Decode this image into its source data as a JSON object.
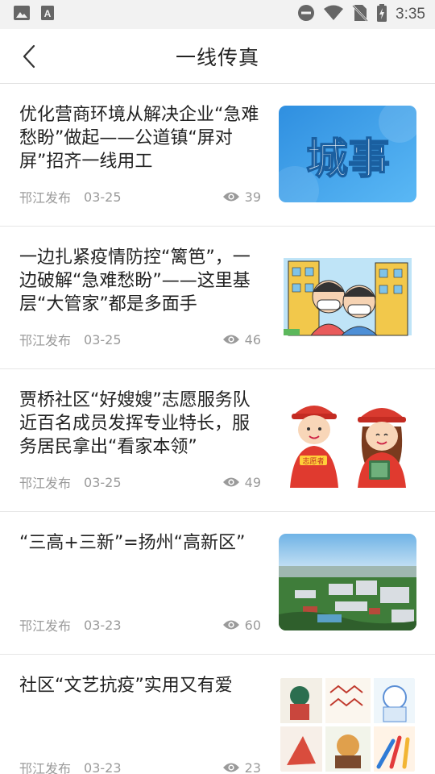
{
  "status_bar": {
    "time": "3:35",
    "icons": [
      "image-icon",
      "text-a-icon",
      "do-not-disturb-icon",
      "wifi-icon",
      "no-sim-icon",
      "battery-charging-icon"
    ]
  },
  "header": {
    "title": "一线传真",
    "back_icon": "chevron-left-icon"
  },
  "articles": [
    {
      "title": "优化营商环境从解决企业“急难愁盼”做起——公道镇“屏对屏”招齐一线用工",
      "source": "邗江发布",
      "date": "03-25",
      "views": "39",
      "thumb_text": "城事",
      "thumb_icon": "city-news-banner"
    },
    {
      "title": "一边扎紧疫情防控“篱笆”，一边破解“急难愁盼”——这里基层“大管家”都是多面手",
      "source": "邗江发布",
      "date": "03-25",
      "views": "46",
      "thumb_icon": "masked-workers-illustration"
    },
    {
      "title": "贾桥社区“好嫂嫂”志愿服务队近百名成员发挥专业特长，服务居民拿出“看家本领”",
      "source": "邗江发布",
      "date": "03-25",
      "views": "49",
      "thumb_text": "志愿者",
      "thumb_icon": "volunteers-illustration"
    },
    {
      "title": "“三高+三新”=扬州“高新区”",
      "source": "邗江发布",
      "date": "03-23",
      "views": "60",
      "thumb_icon": "aerial-city-photo"
    },
    {
      "title": "社区“文艺抗疫”实用又有爱",
      "source": "邗江发布",
      "date": "03-23",
      "views": "23",
      "thumb_icon": "art-collage-image"
    }
  ],
  "colors": {
    "accent_blue": "#2f8fe0",
    "meta_gray": "#9a9a9a",
    "divider": "#e6e6e6"
  }
}
